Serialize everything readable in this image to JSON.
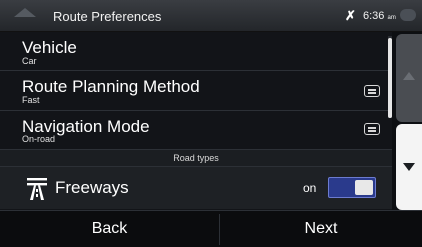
{
  "header": {
    "title": "Route Preferences",
    "time": "6:36",
    "time_suffix": "am",
    "satellite_icon": "satellite-icon"
  },
  "rows": [
    {
      "title": "Vehicle",
      "subtitle": "Car"
    },
    {
      "title": "Route Planning Method",
      "subtitle": "Fast",
      "icon": "list-icon"
    },
    {
      "title": "Navigation Mode",
      "subtitle": "On-road",
      "icon": "list-icon"
    }
  ],
  "section": {
    "label": "Road types"
  },
  "freeways": {
    "label": "Freeways",
    "state": "on",
    "icon": "freeway-icon"
  },
  "footer": {
    "back_label": "Back",
    "next_label": "Next"
  },
  "colors": {
    "toggle_on": "#2a3a8c",
    "background": "#0d0f12"
  }
}
